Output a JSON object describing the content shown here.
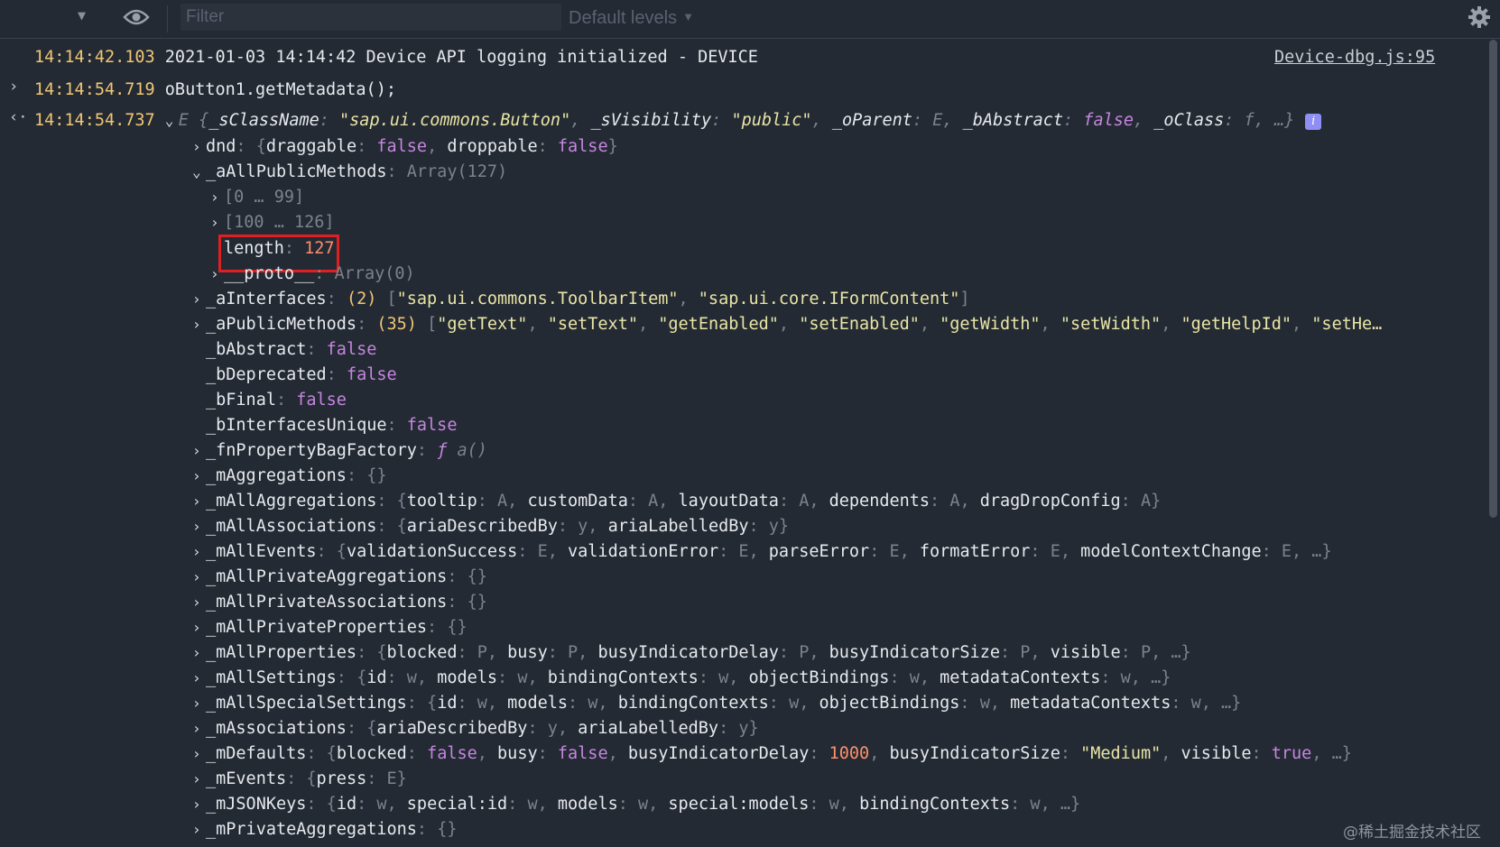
{
  "toolbar": {
    "filter_placeholder": "Filter",
    "levels_label": "Default levels",
    "icons": [
      "chevron-down-icon",
      "eye-icon",
      "gear-icon"
    ]
  },
  "log": {
    "l1_ts": "14:14:42.103",
    "l1_msg": "2021-01-03 14:14:42 Device API logging initialized - DEVICE",
    "l1_src": "Device-dbg.js:95",
    "l2_ts": "14:14:54.719",
    "l2_msg": "oButton1.getMetadata();",
    "l3_ts": "14:14:54.737"
  },
  "obj": {
    "summary_prefix": "E",
    "sClassName_key": "_sClassName",
    "sClassName_val": "\"sap.ui.commons.Button\"",
    "sVisibility_key": "_sVisibility",
    "sVisibility_val": "\"public\"",
    "oParent_key": "_oParent",
    "oParent_val": "E",
    "bAbstract_key": "_bAbstract",
    "bAbstract_val": "false",
    "oClass_key": "_oClass",
    "oClass_val": "f",
    "ellipsis": "…}"
  },
  "props": {
    "dnd_key": "dnd",
    "dnd_k1": "draggable",
    "dnd_v1": "false",
    "dnd_k2": "droppable",
    "dnd_v2": "false",
    "apm_key": "_aAllPublicMethods",
    "apm_val": "Array(127)",
    "range1": "[0 … 99]",
    "range2": "[100 … 126]",
    "length_key": "length",
    "length_val": "127",
    "proto_key": "__proto__",
    "proto_val": "Array(0)",
    "aInterfaces_key": "_aInterfaces",
    "aInterfaces_count": "(2)",
    "aInterfaces_v1": "\"sap.ui.commons.ToolbarItem\"",
    "aInterfaces_v2": "\"sap.ui.core.IFormContent\"",
    "aPublic_key": "_aPublicMethods",
    "aPublic_count": "(35)",
    "aPublic_v1": "\"getText\"",
    "aPublic_v2": "\"setText\"",
    "aPublic_v3": "\"getEnabled\"",
    "aPublic_v4": "\"setEnabled\"",
    "aPublic_v5": "\"getWidth\"",
    "aPublic_v6": "\"setWidth\"",
    "aPublic_v7": "\"getHelpId\"",
    "aPublic_v8": "\"setHe…",
    "bAbstract_key": "_bAbstract",
    "bAbstract_val": "false",
    "bDeprecated_key": "_bDeprecated",
    "bDeprecated_val": "false",
    "bFinal_key": "_bFinal",
    "bFinal_val": "false",
    "bIU_key": "_bInterfacesUnique",
    "bIU_val": "false",
    "fnPBF_key": "_fnPropertyBagFactory",
    "fnPBF_f": "ƒ",
    "fnPBF_val": "a()",
    "mAggr_key": "_mAggregations",
    "mAggr_val": "{}",
    "mAllAggr_key": "_mAllAggregations",
    "mAllAggr_k1": "tooltip",
    "mAllAggr_v1": "A",
    "mAllAggr_k2": "customData",
    "mAllAggr_v2": "A",
    "mAllAggr_k3": "layoutData",
    "mAllAggr_v3": "A",
    "mAllAggr_k4": "dependents",
    "mAllAggr_v4": "A",
    "mAllAggr_k5": "dragDropConfig",
    "mAllAggr_v5": "A",
    "mAllAssoc_key": "_mAllAssociations",
    "mAllAssoc_k1": "ariaDescribedBy",
    "mAllAssoc_v1": "y",
    "mAllAssoc_k2": "ariaLabelledBy",
    "mAllAssoc_v2": "y",
    "mAllEv_key": "_mAllEvents",
    "mAllEv_k1": "validationSuccess",
    "mAllEv_v1": "E",
    "mAllEv_k2": "validationError",
    "mAllEv_v2": "E",
    "mAllEv_k3": "parseError",
    "mAllEv_v3": "E",
    "mAllEv_k4": "formatError",
    "mAllEv_v4": "E",
    "mAllEv_k5": "modelContextChange",
    "mAllEv_v5": "E",
    "mAllPA_key": "_mAllPrivateAggregations",
    "mAllPA_val": "{}",
    "mAllPAs_key": "_mAllPrivateAssociations",
    "mAllPAs_val": "{}",
    "mAllPP_key": "_mAllPrivateProperties",
    "mAllPP_val": "{}",
    "mAllProps_key": "_mAllProperties",
    "mAllProps_k1": "blocked",
    "mAllProps_v1": "P",
    "mAllProps_k2": "busy",
    "mAllProps_v2": "P",
    "mAllProps_k3": "busyIndicatorDelay",
    "mAllProps_v3": "P",
    "mAllProps_k4": "busyIndicatorSize",
    "mAllProps_v4": "P",
    "mAllProps_k5": "visible",
    "mAllProps_v5": "P",
    "mAllSet_key": "_mAllSettings",
    "mAllSet_k1": "id",
    "mAllSet_v1": "w",
    "mAllSet_k2": "models",
    "mAllSet_v2": "w",
    "mAllSet_k3": "bindingContexts",
    "mAllSet_v3": "w",
    "mAllSet_k4": "objectBindings",
    "mAllSet_v4": "w",
    "mAllSet_k5": "metadataContexts",
    "mAllSet_v5": "w",
    "mAllSS_key": "_mAllSpecialSettings",
    "mAllSS_k1": "id",
    "mAllSS_v1": "w",
    "mAllSS_k2": "models",
    "mAllSS_v2": "w",
    "mAllSS_k3": "bindingContexts",
    "mAllSS_v3": "w",
    "mAllSS_k4": "objectBindings",
    "mAllSS_v4": "w",
    "mAllSS_k5": "metadataContexts",
    "mAllSS_v5": "w",
    "mAssoc_key": "_mAssociations",
    "mAssoc_k1": "ariaDescribedBy",
    "mAssoc_v1": "y",
    "mAssoc_k2": "ariaLabelledBy",
    "mAssoc_v2": "y",
    "mDef_key": "_mDefaults",
    "mDef_k1": "blocked",
    "mDef_v1": "false",
    "mDef_k2": "busy",
    "mDef_v2": "false",
    "mDef_k3": "busyIndicatorDelay",
    "mDef_v3": "1000",
    "mDef_k4": "busyIndicatorSize",
    "mDef_v4": "\"Medium\"",
    "mDef_k5": "visible",
    "mDef_v5": "true",
    "mEv_key": "_mEvents",
    "mEv_k1": "press",
    "mEv_v1": "E",
    "mJSON_key": "_mJSONKeys",
    "mJSON_k1": "id",
    "mJSON_v1": "w",
    "mJSON_k2": "special:id",
    "mJSON_v2": "w",
    "mJSON_k3": "models",
    "mJSON_v3": "w",
    "mJSON_k4": "special:models",
    "mJSON_v4": "w",
    "mJSON_k5": "bindingContexts",
    "mJSON_v5": "w",
    "mPrivAggr_key": "_mPrivateAggregations",
    "mPrivAggr_val": "{}"
  },
  "watermark": "@稀土掘金技术社区"
}
